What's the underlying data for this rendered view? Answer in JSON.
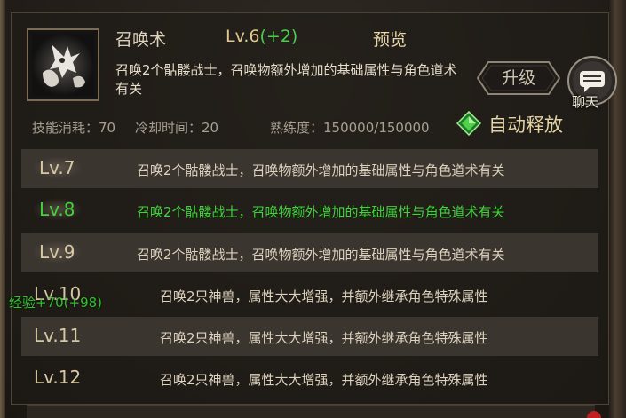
{
  "skill": {
    "name": "召唤术",
    "level": "Lv.6",
    "level_bonus": "(+2)",
    "preview_label": "预览",
    "description": "召唤2个骷髅战士，召唤物额外增加的基础属性与角色道术有关",
    "icon": "skeleton-summon-icon"
  },
  "actions": {
    "upgrade_label": "升级",
    "chat_label": "聊天"
  },
  "stats": {
    "cost_label": "技能消耗：70",
    "cooldown_label": "冷却时间：20",
    "proficiency_label": "熟练度：150000/150000",
    "auto_release_label": "自动释放",
    "auto_release_icon": "green-diamond-icon"
  },
  "levels": [
    {
      "level": "Lv.7",
      "text": "召唤2个骷髅战士，召唤物额外增加的基础属性与角色道术有关",
      "highlight": false
    },
    {
      "level": "Lv.8",
      "text": "召唤2个骷髅战士，召唤物额外增加的基础属性与角色道术有关",
      "highlight": true
    },
    {
      "level": "Lv.9",
      "text": "召唤2个骷髅战士，召唤物额外增加的基础属性与角色道术有关",
      "highlight": false
    },
    {
      "level": "Lv.10",
      "text": "召唤2只神兽，属性大大增强，并额外继承角色特殊属性",
      "highlight": false
    },
    {
      "level": "Lv.11",
      "text": "召唤2只神兽，属性大大增强，并额外继承角色特殊属性",
      "highlight": false
    },
    {
      "level": "Lv.12",
      "text": "召唤2只神兽，属性大大增强，并额外继承角色特殊属性",
      "highlight": false
    }
  ],
  "floating_text": "经验+70(+98)",
  "colors": {
    "highlight_green": "#3fd43c",
    "gold_text": "#e0c98e",
    "row_shade": "#3b3530"
  }
}
